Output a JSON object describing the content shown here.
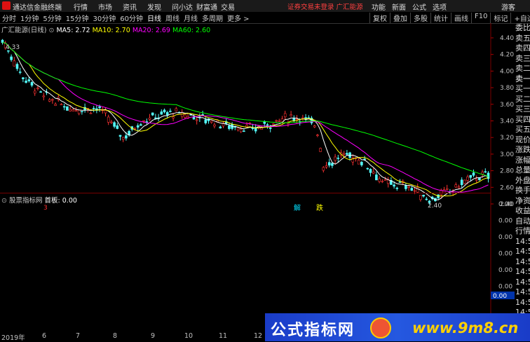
{
  "titlebar": {
    "app_name": "通达信金融终端",
    "menus": [
      "行情",
      "市场",
      "资讯",
      "发现",
      "问小达",
      "财富通",
      "交易"
    ],
    "warning": "证券交易未登录  广汇能源",
    "right": [
      "功能",
      "新面",
      "公式",
      "选项"
    ],
    "guest": "游客"
  },
  "period_bar": {
    "periods": [
      "分时",
      "1分钟",
      "5分钟",
      "15分钟",
      "30分钟",
      "60分钟",
      "日线",
      "周线",
      "月线",
      "多周期",
      "更多 >"
    ],
    "active": "日线",
    "buttons": [
      "复权",
      "叠加",
      "多股",
      "统计",
      "画线",
      "F10",
      "标记",
      "+自选",
      "◁"
    ]
  },
  "legend": {
    "stock": "广汇能源(日线)",
    "ma5": "MA5: 2.72",
    "ma10": "MA10: 2.70",
    "ma20": "MA20: 2.69",
    "ma60": "MA60: 2.60",
    "colors": {
      "ma5": "#ffffff",
      "ma10": "#ffff00",
      "ma20": "#ff00ff",
      "ma60": "#00ff00"
    }
  },
  "lower": {
    "indicator": "股票指标网",
    "label": "首板: 0.00",
    "yticks": [
      "0.00",
      "0.00",
      "0.00",
      "0.00",
      "0.00",
      "0.00"
    ],
    "value_box": "0.00"
  },
  "chart_data": {
    "type": "candlestick",
    "yticks": [
      "4.40",
      "4.20",
      "4.00",
      "3.80",
      "3.60",
      "3.40",
      "3.20",
      "3.00",
      "2.80",
      "2.60",
      "2.40"
    ],
    "high_label": "4.33",
    "low_label": "2.40",
    "signals": [
      "3",
      "解",
      "跌"
    ],
    "x_labels": [
      "2019年",
      "6",
      "7",
      "8",
      "9",
      "10",
      "11",
      "12"
    ],
    "ma_lines": [
      "MA5",
      "MA10",
      "MA20",
      "MA60"
    ]
  },
  "right_panel": [
    "委比",
    "卖五",
    "卖四",
    "卖三",
    "卖二",
    "卖一",
    "买一",
    "买二",
    "买三",
    "买四",
    "买五",
    "现价",
    "涨跌",
    "涨幅",
    "总量",
    "外盘",
    "换手",
    "净资",
    "收益",
    "自动",
    "行情",
    "14:50",
    "14:50",
    "14:50",
    "14:50",
    "14:50",
    "14:50",
    "14:50",
    "14:50"
  ],
  "banner": {
    "text1": "公式指标网",
    "text2": "www.9m8.cn"
  }
}
